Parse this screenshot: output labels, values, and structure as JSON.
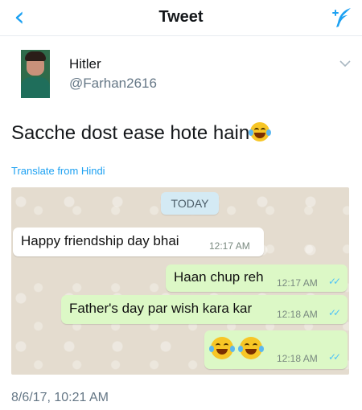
{
  "header": {
    "title": "Tweet",
    "back_icon": "chevron-left-icon",
    "compose_icon": "compose-tweet-icon",
    "accent": "#1da1f2"
  },
  "author": {
    "name": "Hitler",
    "handle": "@Farhan2616"
  },
  "tweet": {
    "text": "Sacche dost ease hote hain",
    "emoji": "face-with-tears-of-joy",
    "translate_label": "Translate from Hindi",
    "timestamp": "8/6/17, 10:21 AM"
  },
  "chat": {
    "date_label": "TODAY",
    "messages": [
      {
        "direction": "in",
        "text": "Happy friendship day bhai",
        "time": "12:17 AM"
      },
      {
        "direction": "out",
        "text": "Haan chup reh",
        "time": "12:17 AM",
        "status": "read"
      },
      {
        "direction": "out",
        "text": "Father's day par wish kara kar",
        "time": "12:18 AM",
        "status": "read"
      },
      {
        "direction": "out",
        "text": "",
        "emoji": [
          "face-with-tears-of-joy",
          "face-with-tears-of-joy"
        ],
        "time": "12:18 AM",
        "status": "read"
      }
    ]
  }
}
